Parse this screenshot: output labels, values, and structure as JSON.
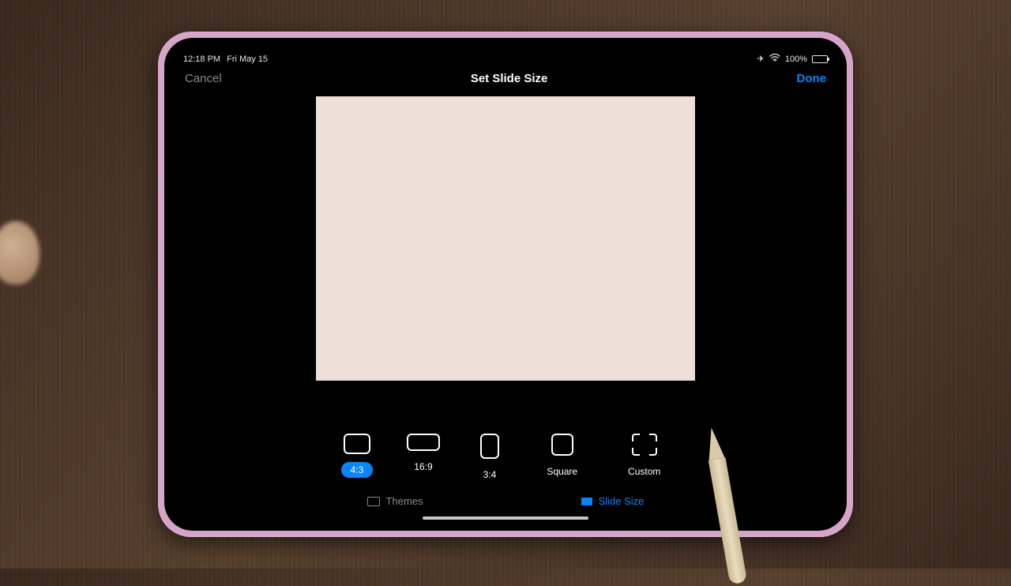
{
  "status": {
    "time": "12:18 PM",
    "date": "Fri May 15",
    "battery_percent": "100%"
  },
  "nav": {
    "cancel": "Cancel",
    "title": "Set Slide Size",
    "done": "Done"
  },
  "size_options": [
    {
      "id": "4-3",
      "label": "4:3",
      "selected": true
    },
    {
      "id": "16-9",
      "label": "16:9",
      "selected": false
    },
    {
      "id": "3-4",
      "label": "3:4",
      "selected": false
    },
    {
      "id": "square",
      "label": "Square",
      "selected": false
    },
    {
      "id": "custom",
      "label": "Custom",
      "selected": false
    }
  ],
  "tabs": {
    "themes": "Themes",
    "slide_size": "Slide Size"
  }
}
